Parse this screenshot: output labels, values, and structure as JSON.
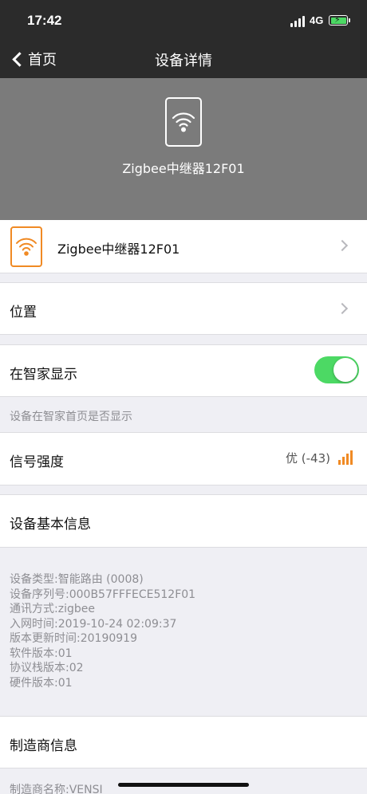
{
  "status_bar": {
    "time": "17:42",
    "network": "4G",
    "battery_color": "#4cd964"
  },
  "nav": {
    "back_label": "首页",
    "title": "设备详情"
  },
  "hero": {
    "device_name": "Zigbee中继器12F01",
    "background": "#7b7b7b"
  },
  "device_row": {
    "name": "Zigbee中继器12F01",
    "icon_color": "#f08a24"
  },
  "location": {
    "label": "位置"
  },
  "smart_home": {
    "label": "在智家显示",
    "enabled": true,
    "hint": "设备在智家首页是否显示",
    "toggle_color": "#4cd964"
  },
  "signal": {
    "label": "信号强度",
    "value": "优 (-43)"
  },
  "basic_info": {
    "header": "设备基本信息",
    "lines": [
      "设备类型:智能路由 (0008)",
      "设备序列号:000B57FFFECE512F01",
      "通讯方式:zigbee",
      "入网时间:2019-10-24 02:09:37",
      "版本更新时间:20190919",
      "软件版本:01",
      "协议栈版本:02",
      "硬件版本:01"
    ]
  },
  "manufacturer": {
    "header": "制造商信息",
    "name_line": "制造商名称:VENSI"
  }
}
